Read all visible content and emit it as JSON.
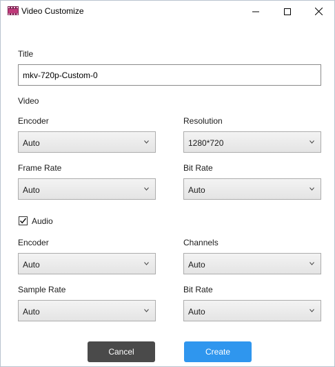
{
  "window": {
    "title": "Video Customize"
  },
  "title_section": {
    "label": "Title",
    "value": "mkv-720p-Custom-0"
  },
  "video": {
    "heading": "Video",
    "encoder": {
      "label": "Encoder",
      "value": "Auto"
    },
    "resolution": {
      "label": "Resolution",
      "value": "1280*720"
    },
    "frame_rate": {
      "label": "Frame Rate",
      "value": "Auto"
    },
    "bit_rate": {
      "label": "Bit Rate",
      "value": "Auto"
    }
  },
  "audio": {
    "checkbox_label": "Audio",
    "checked": true,
    "encoder": {
      "label": "Encoder",
      "value": "Auto"
    },
    "channels": {
      "label": "Channels",
      "value": "Auto"
    },
    "sample_rate": {
      "label": "Sample Rate",
      "value": "Auto"
    },
    "bit_rate": {
      "label": "Bit Rate",
      "value": "Auto"
    }
  },
  "buttons": {
    "cancel": "Cancel",
    "create": "Create"
  },
  "colors": {
    "create_button": "#2f96ee",
    "cancel_button": "#4a4a4a"
  }
}
